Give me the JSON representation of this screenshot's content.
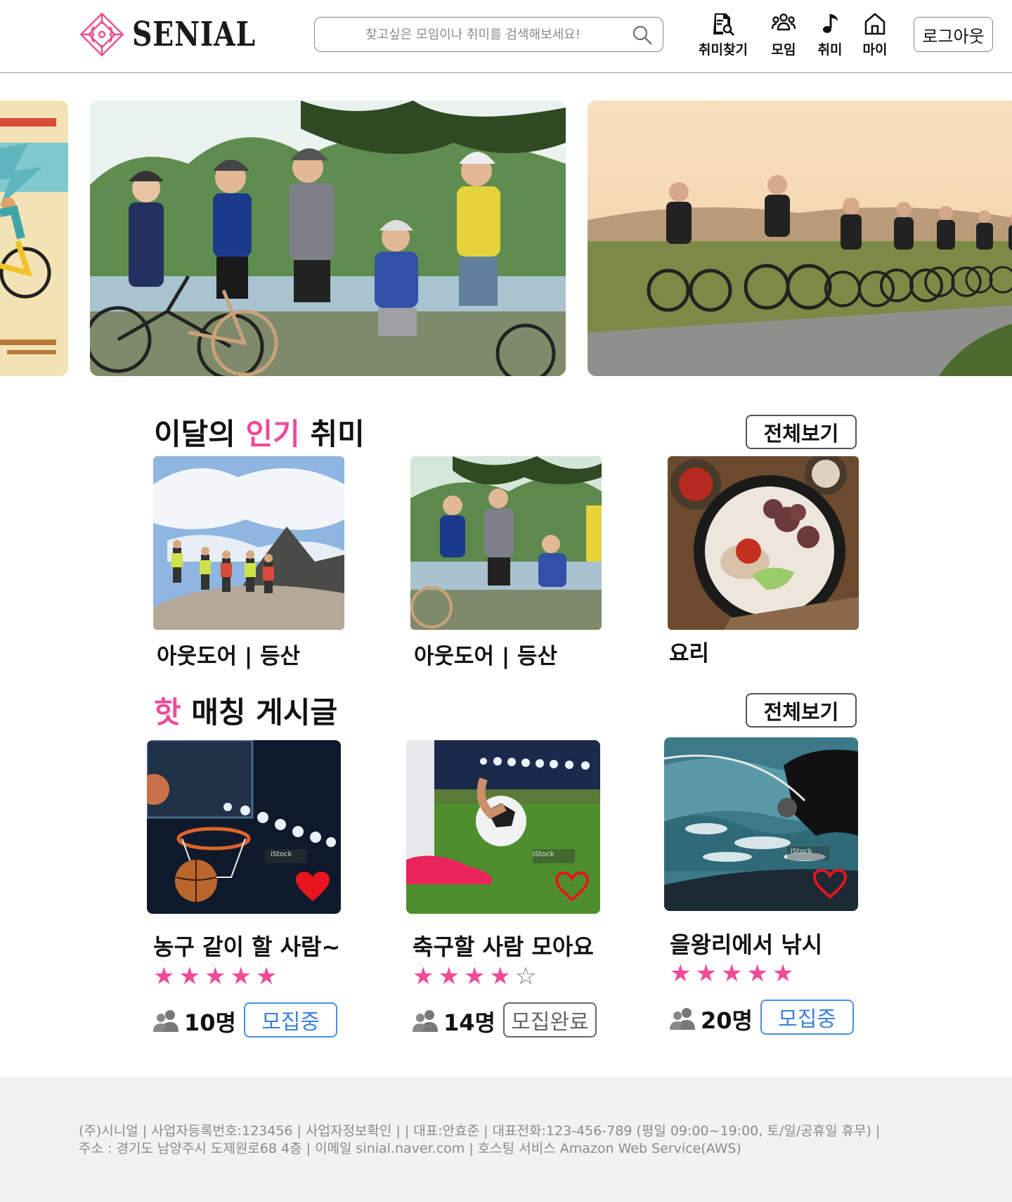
{
  "header": {
    "logo_text": "SENIAL",
    "search_placeholder": "찾고싶은 모임이나 취미를 검색해보세요!",
    "nav": [
      {
        "label": "취미찾기",
        "icon": "hobby-search-icon"
      },
      {
        "label": "모임",
        "icon": "group-icon"
      },
      {
        "label": "취미",
        "icon": "music-note-icon"
      },
      {
        "label": "마이",
        "icon": "home-icon"
      }
    ],
    "logout_label": "로그아웃"
  },
  "popular": {
    "title_prefix": "이달의 ",
    "title_highlight": "인기",
    "title_suffix": " 취미",
    "view_all": "전체보기",
    "items": [
      {
        "label": "아웃도어 | 등산"
      },
      {
        "label": "아웃도어 | 등산"
      },
      {
        "label": "요리"
      }
    ]
  },
  "hot": {
    "title_highlight": "핫",
    "title_suffix": " 매칭 게시글",
    "view_all": "전체보기",
    "posts": [
      {
        "title": "농구 같이 할 사람~",
        "rating": 5,
        "members": "10명",
        "status": "모집중",
        "liked": true
      },
      {
        "title": "축구할 사람 모아요",
        "rating": 4,
        "members": "14명",
        "status": "모집완료",
        "liked": false
      },
      {
        "title": "을왕리에서 낚시",
        "rating": 5,
        "members": "20명",
        "status": "모집중",
        "liked": false
      }
    ]
  },
  "footer": {
    "line1": "(주)시니얼 | 사업자등록번호:123456 | 사업자정보확인 | | 대표:안효준 | 대표전화:123-456-789 (평일 09:00~19:00, 토/일/공휴일 휴무) |",
    "line2": "주소 : 경기도 남양주시 도제원로68 4층 | 이메일 sinial.naver.com | 호스팅 서비스 Amazon Web Service(AWS)"
  },
  "colors": {
    "accent_pink": "#f04a98",
    "status_open": "#3b7fe0",
    "status_closed": "#666666"
  }
}
